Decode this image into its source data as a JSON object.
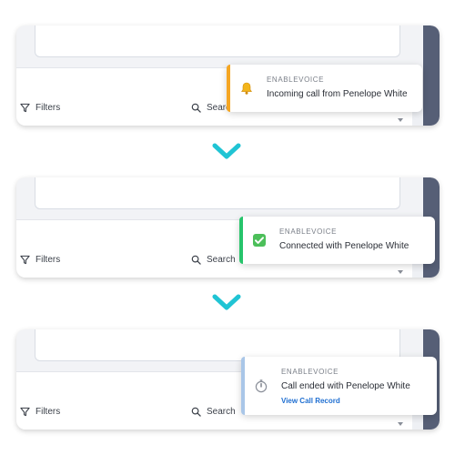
{
  "toolbar": {
    "filters_label": "Filters",
    "search_label": "Search"
  },
  "notifications": [
    {
      "source": "ENABLEVOICE",
      "message": "Incoming call from Penelope White",
      "icon": "bell-icon",
      "accent": "#f5a623"
    },
    {
      "source": "ENABLEVOICE",
      "message": "Connected with Penelope White",
      "icon": "check-icon",
      "accent": "#27c46b"
    },
    {
      "source": "ENABLEVOICE",
      "message": "Call ended with Penelope White",
      "link": "View Call Record",
      "icon": "stopwatch-icon",
      "accent": "#a9c6e8"
    }
  ],
  "colors": {
    "arrow": "#20c4d4",
    "rail": "#565f76",
    "link": "#1f6fd1"
  }
}
